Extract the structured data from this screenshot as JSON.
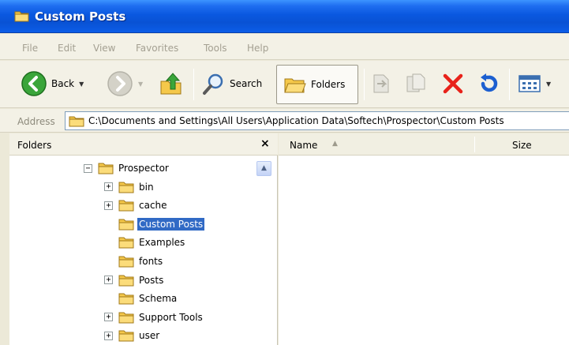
{
  "window": {
    "title": "Custom Posts"
  },
  "menu": [
    "File",
    "Edit",
    "View",
    "Favorites",
    "Tools",
    "Help"
  ],
  "toolbar": {
    "back_label": "Back",
    "search_label": "Search",
    "folders_label": "Folders"
  },
  "address": {
    "label": "Address",
    "path": "C:\\Documents and Settings\\All Users\\Application Data\\Softech\\Prospector\\Custom Posts"
  },
  "folders_pane": {
    "title": "Folders",
    "close_glyph": "×",
    "tree": [
      {
        "label": "Prospector",
        "expander": "⊟",
        "selected": false
      },
      {
        "label": "bin",
        "expander": "⊞",
        "selected": false
      },
      {
        "label": "cache",
        "expander": "⊞",
        "selected": false
      },
      {
        "label": "Custom Posts",
        "expander": "",
        "selected": true
      },
      {
        "label": "Examples",
        "expander": "",
        "selected": false
      },
      {
        "label": "fonts",
        "expander": "",
        "selected": false
      },
      {
        "label": "Posts",
        "expander": "⊞",
        "selected": false
      },
      {
        "label": "Schema",
        "expander": "",
        "selected": false
      },
      {
        "label": "Support Tools",
        "expander": "⊞",
        "selected": false
      },
      {
        "label": "user",
        "expander": "⊞",
        "selected": false
      }
    ]
  },
  "list_view": {
    "columns": [
      "Name",
      "Size"
    ]
  },
  "colors": {
    "titlebar": "#0a58e0",
    "selection": "#316ac5",
    "folder": "#f5c84a"
  }
}
